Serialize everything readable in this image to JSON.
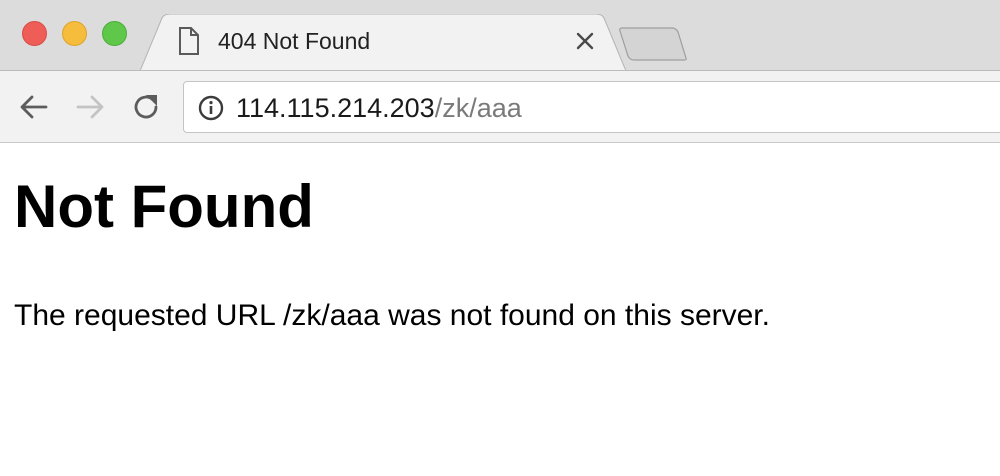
{
  "window": {
    "controls": [
      "close",
      "minimize",
      "maximize"
    ]
  },
  "tab": {
    "title": "404 Not Found",
    "icon": "page-icon",
    "close_icon": "close-icon"
  },
  "toolbar": {
    "back_icon": "arrow-left-icon",
    "forward_icon": "arrow-right-icon",
    "reload_icon": "reload-icon",
    "address": {
      "info_icon": "info-icon",
      "host": "114.115.214.203",
      "path": "/zk/aaa"
    }
  },
  "page": {
    "heading": "Not Found",
    "message": "The requested URL /zk/aaa was not found on this server."
  },
  "colors": {
    "tabstrip": "#dcdcdc",
    "toolbar": "#f2f2f2",
    "close": "#ee5e57",
    "minimize": "#f5bd3b",
    "maximize": "#5fc84a",
    "url_path": "#7a7a7a"
  }
}
